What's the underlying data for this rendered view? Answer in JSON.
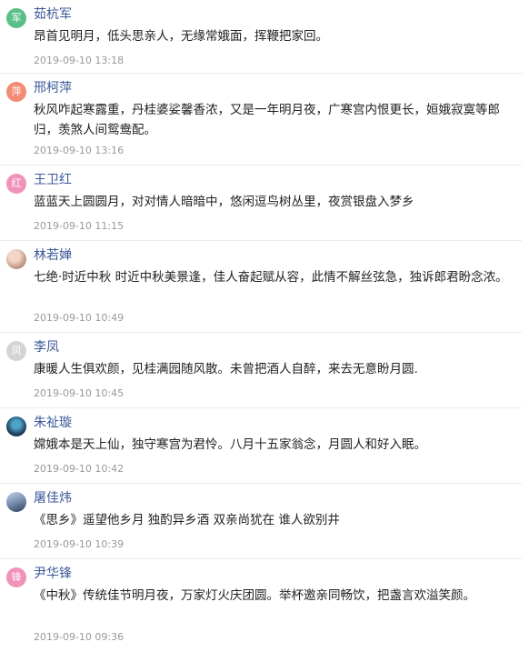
{
  "comments": [
    {
      "name": "茹杭军",
      "avatar_char": "军",
      "avatar_color": "#5bbf8a",
      "text": "昂首见明月，低头思亲人，无缘常娥面，挥鞭把家回。",
      "time": "2019-09-10 13:18"
    },
    {
      "name": "邢柯萍",
      "avatar_char": "萍",
      "avatar_color": "#f28c74",
      "text": "秋风咋起寒露重，丹桂婆娑馨香浓，又是一年明月夜，广寒宫内恨更长，姮娥寂寞等郎归，羡煞人间鸳鸯配。",
      "time": "2019-09-10 13:16"
    },
    {
      "name": "王卫红",
      "avatar_char": "红",
      "avatar_color": "#f292b9",
      "text": "蓝蓝天上圆圆月，对对情人暗暗中，悠闲逗鸟树丛里，夜赏银盘入梦乡",
      "time": "2019-09-10 11:15"
    },
    {
      "name": "林若婵",
      "avatar_char": "",
      "avatar_color": "#c9a28f",
      "text": "七绝·时近中秋 时近中秋美景逢，佳人奋起赋从容，此情不解丝弦急，独诉郎君盼念浓。",
      "time": "2019-09-10 10:49"
    },
    {
      "name": "李凤",
      "avatar_char": "凤",
      "avatar_color": "#d4d4d4",
      "text": "康暖人生俱欢颜，见桂满园随风散。未曾把酒人自醉，来去无意盼月圆.",
      "time": "2019-09-10 10:45"
    },
    {
      "name": "朱祉璇",
      "avatar_char": "",
      "avatar_color": "#1b3d5c",
      "text": "嫦娥本是天上仙，独守寒宫为君怜。八月十五家翁念，月圆人和好入眠。",
      "time": "2019-09-10 10:42"
    },
    {
      "name": "屠佳炜",
      "avatar_char": "",
      "avatar_color": "#6f86a8",
      "text": "《思乡》遥望他乡月 独酌异乡酒 双亲尚犹在 谁人欲别井",
      "time": "2019-09-10 10:39"
    },
    {
      "name": "尹华锋",
      "avatar_char": "锋",
      "avatar_color": "#f292b9",
      "text": "《中秋》传统佳节明月夜，万家灯火庆团圆。举杯邀亲同畅饮，把盏言欢溢笑颜。",
      "time": "2019-09-10 09:36"
    }
  ]
}
